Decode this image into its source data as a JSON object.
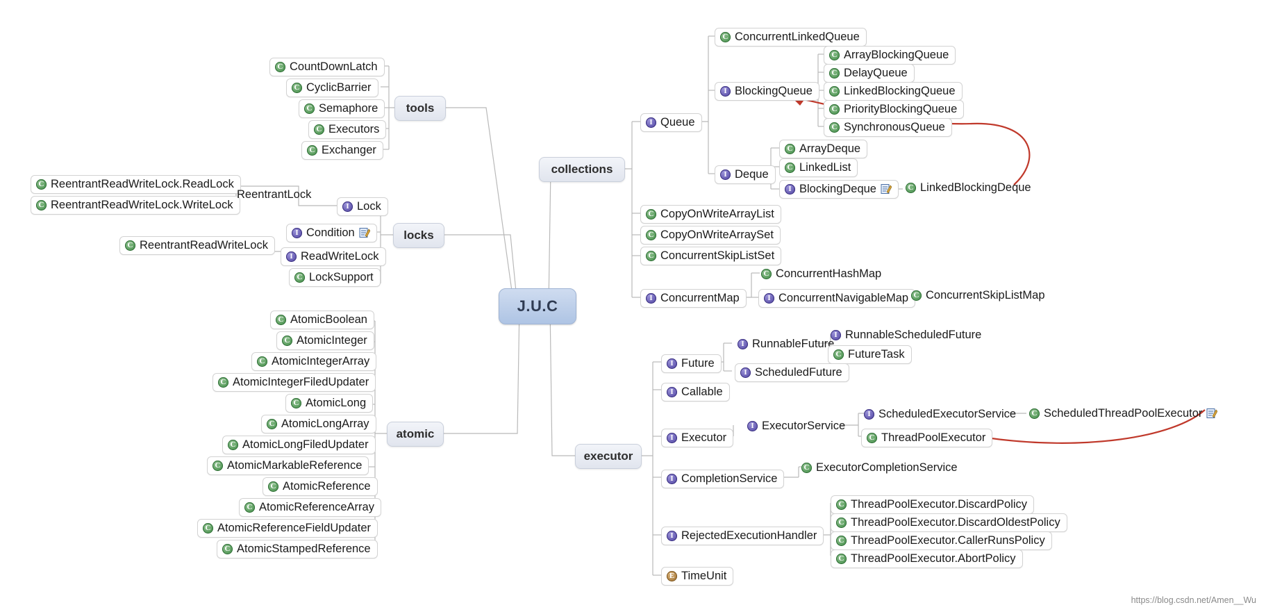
{
  "root": {
    "label": "J.U.C"
  },
  "branches": [
    {
      "id": "tools",
      "label": "tools"
    },
    {
      "id": "locks",
      "label": "locks"
    },
    {
      "id": "atomic",
      "label": "atomic"
    },
    {
      "id": "collections",
      "label": "collections"
    },
    {
      "id": "executor",
      "label": "executor"
    }
  ],
  "nodes": {
    "tools": [
      {
        "label": "CountDownLatch",
        "kind": "class"
      },
      {
        "label": "CyclicBarrier",
        "kind": "class"
      },
      {
        "label": "Semaphore",
        "kind": "class"
      },
      {
        "label": "Executors",
        "kind": "class"
      },
      {
        "label": "Exchanger",
        "kind": "class"
      }
    ],
    "locks": [
      {
        "label": "ReentrantReadWriteLock.ReadLock",
        "kind": "class"
      },
      {
        "label": "ReentrantReadWriteLock.WriteLock",
        "kind": "class"
      },
      {
        "label": "ReentrantLock",
        "kind": "plain"
      },
      {
        "label": "Lock",
        "kind": "interface"
      },
      {
        "label": "Condition",
        "kind": "interface",
        "note": true
      },
      {
        "label": "ReentrantReadWriteLock",
        "kind": "class"
      },
      {
        "label": "ReadWriteLock",
        "kind": "interface"
      },
      {
        "label": "LockSupport",
        "kind": "class"
      }
    ],
    "atomic": [
      {
        "label": "AtomicBoolean",
        "kind": "class"
      },
      {
        "label": "AtomicInteger",
        "kind": "class"
      },
      {
        "label": "AtomicIntegerArray",
        "kind": "class"
      },
      {
        "label": "AtomicIntegerFiledUpdater",
        "kind": "class"
      },
      {
        "label": "AtomicLong",
        "kind": "class"
      },
      {
        "label": "AtomicLongArray",
        "kind": "class"
      },
      {
        "label": "AtomicLongFiledUpdater",
        "kind": "class"
      },
      {
        "label": "AtomicMarkableReference",
        "kind": "class"
      },
      {
        "label": "AtomicReference",
        "kind": "class"
      },
      {
        "label": "AtomicReferenceArray",
        "kind": "class"
      },
      {
        "label": "AtomicReferenceFieldUpdater",
        "kind": "class"
      },
      {
        "label": "AtomicStampedReference",
        "kind": "class"
      }
    ],
    "collections": [
      {
        "label": "Queue",
        "kind": "interface"
      },
      {
        "label": "ConcurrentLinkedQueue",
        "kind": "class"
      },
      {
        "label": "BlockingQueue",
        "kind": "interface"
      },
      {
        "label": "ArrayBlockingQueue",
        "kind": "class"
      },
      {
        "label": "DelayQueue",
        "kind": "class"
      },
      {
        "label": "LinkedBlockingQueue",
        "kind": "class"
      },
      {
        "label": "PriorityBlockingQueue",
        "kind": "class"
      },
      {
        "label": "SynchronousQueue",
        "kind": "class"
      },
      {
        "label": "Deque",
        "kind": "interface"
      },
      {
        "label": "ArrayDeque",
        "kind": "class"
      },
      {
        "label": "LinkedList",
        "kind": "class"
      },
      {
        "label": "BlockingDeque",
        "kind": "interface",
        "note": true
      },
      {
        "label": "LinkedBlockingDeque",
        "kind": "class"
      },
      {
        "label": "CopyOnWriteArrayList",
        "kind": "class"
      },
      {
        "label": "CopyOnWriteArraySet",
        "kind": "class"
      },
      {
        "label": "ConcurrentSkipListSet",
        "kind": "class"
      },
      {
        "label": "ConcurrentMap",
        "kind": "interface"
      },
      {
        "label": "ConcurrentHashMap",
        "kind": "class"
      },
      {
        "label": "ConcurrentNavigableMap",
        "kind": "interface"
      },
      {
        "label": "ConcurrentSkipListMap",
        "kind": "class"
      }
    ],
    "executor": [
      {
        "label": "Future",
        "kind": "interface"
      },
      {
        "label": "RunnableFuture",
        "kind": "interface"
      },
      {
        "label": "RunnableScheduledFuture",
        "kind": "interface"
      },
      {
        "label": "FutureTask",
        "kind": "class"
      },
      {
        "label": "ScheduledFuture",
        "kind": "interface"
      },
      {
        "label": "Callable",
        "kind": "interface"
      },
      {
        "label": "Executor",
        "kind": "interface"
      },
      {
        "label": "ExecutorService",
        "kind": "interface"
      },
      {
        "label": "ScheduledExecutorService",
        "kind": "interface"
      },
      {
        "label": "ScheduledThreadPoolExecutor",
        "kind": "class",
        "note": true
      },
      {
        "label": "ThreadPoolExecutor",
        "kind": "class"
      },
      {
        "label": "CompletionService",
        "kind": "interface"
      },
      {
        "label": "ExecutorCompletionService",
        "kind": "class"
      },
      {
        "label": "RejectedExecutionHandler",
        "kind": "interface"
      },
      {
        "label": "ThreadPoolExecutor.DiscardPolicy",
        "kind": "class"
      },
      {
        "label": "ThreadPoolExecutor.DiscardOldestPolicy",
        "kind": "class"
      },
      {
        "label": "ThreadPoolExecutor.CallerRunsPolicy",
        "kind": "class"
      },
      {
        "label": "ThreadPoolExecutor.AbortPolicy",
        "kind": "class"
      },
      {
        "label": "TimeUnit",
        "kind": "enum"
      }
    ]
  },
  "icon_glyphs": {
    "class": "C",
    "interface": "I",
    "enum": "E",
    "note": "note-icon"
  },
  "colors": {
    "class_green": "#3f8c45",
    "interface_purple": "#4b3f9e",
    "enum_brown": "#9a6b2a",
    "root_blue": "#aec4e4",
    "arrow_red": "#c0392b",
    "edge_gray": "#b9b9b9"
  },
  "watermark": {
    "text": "https://blog.csdn.net/Amen__Wu"
  }
}
